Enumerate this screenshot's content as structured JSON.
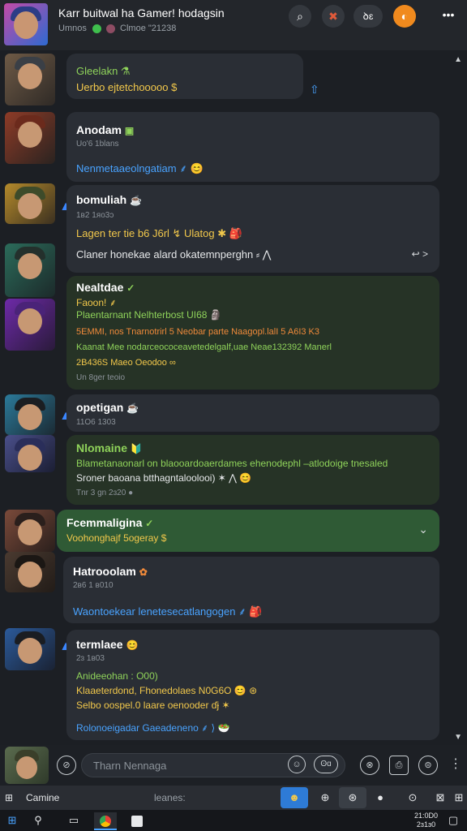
{
  "header": {
    "title": "Karr buitwal ha Gamer! hodagsin",
    "subtitle_left": "Umnos",
    "subtitle_right": "Clmoe \"21238",
    "icons": [
      "search-icon",
      "bolt-icon",
      "controller-icon",
      "orange-status-icon",
      "more-icon"
    ],
    "more_glyph": "•••",
    "search_glyph": "⌕",
    "bolt_glyph": "✖",
    "controller_glyph": "ꝺɛ",
    "orange_glyph": "◐"
  },
  "messages": [
    {
      "lines": [
        "Gleelakn ⚗",
        "Uerbo ejtetchooooo $"
      ]
    },
    {
      "name": "Anodam",
      "badge": "▣",
      "meta": "Uo'6 1blans",
      "lines": [
        "Nenmetaaeolngatiam ⸙ 😊"
      ]
    },
    {
      "name": "bomuliah",
      "badge": "☕",
      "meta": "1ʙ2 1ᴙo3ᴐ",
      "lines": [
        "Lagen ter tie b6 J6rl ↯ Ulatog ✱ 🎒",
        "Claner honekae alard okatemnperghn ⸗ ⋀"
      ],
      "tail": "↩ >"
    },
    {
      "name": "Nealtdae",
      "badge": "✓",
      "lines": [
        "Faoon! ⸙",
        "Plaentarnant Nelhterbost UI68 🗿",
        "5EMMI, nos Tnarnotrirl 5 Neobar parte Naagopl.lalI 5 A6I3 K3",
        "Kaanat Mee nodarceococeavetedelgalf,uae Neae132392 Manerl",
        "2B436S Maeo Oeodoo ∞",
        "Un 8ger teoio"
      ]
    },
    {
      "name": "opetigan",
      "badge": "☕",
      "meta": "11O6 1303"
    },
    {
      "name": "Nlomaine",
      "badge": "🔰",
      "lines": [
        "Blametanaonarl on blaooardoaerdames ehenodephl –atlodoige tnesaled",
        "Sroner baoana btthagntaloolooi) ✶ ⋀ 😊",
        "Tnr 3 gn 2ɜ20 ●"
      ]
    },
    {
      "name": "Fcemmaligina",
      "badge": "✓",
      "lines": [
        "Voohonghajf 5ogeray $"
      ]
    },
    {
      "name": "Hatrooolam",
      "badge": "✿",
      "meta": "2ʙ6 1 ʙ010",
      "lines": [
        "Waontoekear lenetesecatlangogen ⸙ 🎒"
      ]
    },
    {
      "name": "termlaee",
      "badge": "😊",
      "meta": "2ɜ 1ʙ03",
      "lines": [
        "Anideeohan : O00)",
        "Klaaeterdond, Fhonedolaes N0G6O 😊 ⊛",
        "Selbo oospel.0 laare oenooder ɗɉ ✶",
        "Rolonoeigadar Gaeadeneno ⸙ ⟩ 🥗"
      ]
    }
  ],
  "composer": {
    "placeholder": "Tharn Nennaga",
    "emoji_glyph": "☺",
    "gif_glyph": "ʘɑ",
    "send_glyphs": [
      "⊗",
      "⎙",
      "⊜",
      "⋮"
    ],
    "attach_glyph": "⊘"
  },
  "bottom_tabs": {
    "left_label": "Camine",
    "mid_label": "leanes:",
    "tabs": [
      "☻",
      "⊕",
      "⊛",
      "●",
      "⊙",
      "⊠",
      "⊞"
    ]
  },
  "taskbar": {
    "clock_time": "21:0D0",
    "clock_date": "2ɜ1ɜ0"
  },
  "colors": {
    "accent_green": "#8fd35a",
    "accent_yellow": "#f2c84b",
    "accent_blue": "#49a3ff",
    "banner_green": "#2f5a35",
    "header_orange": "#f08a1e"
  }
}
